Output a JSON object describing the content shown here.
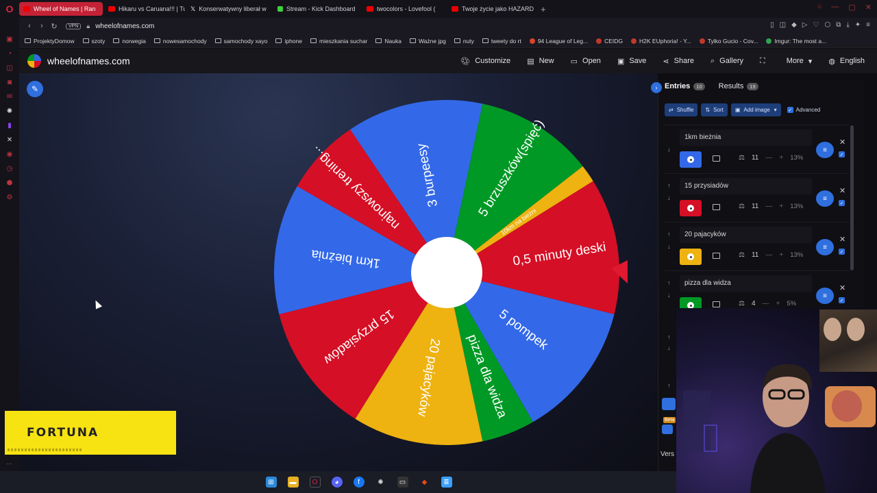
{
  "browser": {
    "tabs": [
      {
        "label": "Wheel of Names | Ran",
        "active": true,
        "icon": "youtube-icon"
      },
      {
        "label": "Hikaru vs Caruana!!! | Tur",
        "active": false,
        "icon": "youtube-icon"
      },
      {
        "label": "Konserwatywny liberał w",
        "active": false,
        "icon": "x-icon"
      },
      {
        "label": "Stream - Kick Dashboard",
        "active": false,
        "icon": "kick-icon"
      },
      {
        "label": "twocolors - Lovefool (",
        "active": false,
        "icon": "youtube-icon"
      },
      {
        "label": "Twoje życie jako HAZARD",
        "active": false,
        "icon": "youtube-icon"
      }
    ],
    "vpn_label": "VPN",
    "url": "wheelofnames.com",
    "bookmarks": [
      {
        "label": "ProjektyDomow",
        "icon": "folder"
      },
      {
        "label": "szoty",
        "icon": "folder"
      },
      {
        "label": "norwegia",
        "icon": "folder"
      },
      {
        "label": "nowesamochody",
        "icon": "folder"
      },
      {
        "label": "samochody xayo",
        "icon": "folder"
      },
      {
        "label": "iphone",
        "icon": "folder"
      },
      {
        "label": "mieszkania suchar",
        "icon": "folder"
      },
      {
        "label": "Nauka",
        "icon": "folder"
      },
      {
        "label": "Ważne jpg",
        "icon": "folder"
      },
      {
        "label": "nuty",
        "icon": "folder"
      },
      {
        "label": "tweety do rt",
        "icon": "folder"
      },
      {
        "label": "94 League of Leg...",
        "icon": "dot",
        "color": "#d9442b"
      },
      {
        "label": "CEIDG",
        "icon": "dot",
        "color": "#c0392b"
      },
      {
        "label": "H2K EUphoria! - Y...",
        "icon": "dot",
        "color": "#c0392b"
      },
      {
        "label": "Tylko Gucio - Cov...",
        "icon": "dot",
        "color": "#c0392b"
      },
      {
        "label": "Imgur: The most a...",
        "icon": "dot",
        "color": "#2ea44f"
      }
    ]
  },
  "site": {
    "name": "wheelofnames.com",
    "menu": [
      {
        "label": "Customize",
        "icon": "palette-icon"
      },
      {
        "label": "New",
        "icon": "file-icon"
      },
      {
        "label": "Open",
        "icon": "folder-open-icon"
      },
      {
        "label": "Save",
        "icon": "save-icon"
      },
      {
        "label": "Share",
        "icon": "share-icon"
      },
      {
        "label": "Gallery",
        "icon": "search-icon"
      },
      {
        "label": "",
        "icon": "fullscreen-icon"
      },
      {
        "label": "More",
        "icon": "chevron-down-icon"
      },
      {
        "label": "English",
        "icon": "globe-icon"
      }
    ]
  },
  "wheel": {
    "segments": [
      {
        "label": "3 burpeesy",
        "color": "#3369e8"
      },
      {
        "label": "5 brzuszków(spięć)",
        "color": "#009925"
      },
      {
        "label": "10km na bieżni",
        "color": "#eeb211"
      },
      {
        "label": "0,5 minuty deski",
        "color": "#d50f25"
      },
      {
        "label": "5 pompek",
        "color": "#3369e8"
      },
      {
        "label": "pizza dla widza",
        "color": "#009925"
      },
      {
        "label": "20 pajacyków",
        "color": "#eeb211"
      },
      {
        "label": "15 przysiadów",
        "color": "#d50f25"
      },
      {
        "label": "1km bieżnia",
        "color": "#3369e8"
      },
      {
        "label": "najnowszy trening...",
        "color": "#d50f25"
      }
    ]
  },
  "panel": {
    "tabs": [
      {
        "label": "Entries",
        "count": "10"
      },
      {
        "label": "Results",
        "count": "19"
      }
    ],
    "toolbar": {
      "shuffle": "Shuffle",
      "sort": "Sort",
      "add_image": "Add image",
      "advanced": "Advanced"
    },
    "entries": [
      {
        "name": "1km bieżnia",
        "color": "#3369e8",
        "weight": "11",
        "pct": "13%"
      },
      {
        "name": "15 przysiadów",
        "color": "#d50f25",
        "weight": "11",
        "pct": "13%"
      },
      {
        "name": "20 pajacyków",
        "color": "#eeb211",
        "weight": "11",
        "pct": "13%"
      },
      {
        "name": "pizza dla widza",
        "color": "#009925",
        "weight": "4",
        "pct": "5%"
      }
    ],
    "beta_label": "Beta",
    "version_label": "Vers"
  },
  "ad": {
    "brand": "FORTUNA"
  }
}
